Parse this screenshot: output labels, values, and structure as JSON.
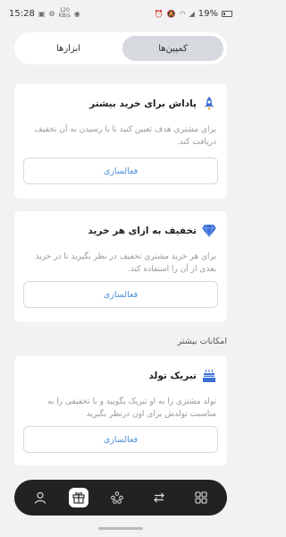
{
  "status_bar": {
    "time": "15:28",
    "network_speed": "120",
    "network_unit": "KB/s",
    "battery": "19%"
  },
  "tabs": {
    "campaigns": "کمپین‌ها",
    "tools": "ابزارها",
    "active": "campaigns"
  },
  "cards": [
    {
      "icon": "rocket-icon",
      "title": "پاداش برای خرید بیشتر",
      "description": "برای مشتری هدف تعیین کنید تا با رسیدن به آن تخفیف دریافت کند.",
      "button": "فعالسازی"
    },
    {
      "icon": "diamond-icon",
      "title": "تخفیف به ازای هر خرید",
      "description": "برای هر خرید مشتری تخفیف در نظر بگیرید تا در خرید بعدی از آن را استفاده کند.",
      "button": "فعالسازی"
    },
    {
      "icon": "cake-icon",
      "title": "تبریک تولد",
      "description": "تولد مشتری را به او تبریک بگویید و با تخفیفی را به مناسبت تولدش برای اون درنظر بگیرید",
      "button": "فعالسازی"
    }
  ],
  "section_label": "امکانات بیشتر",
  "nav": {
    "items": [
      "profile-icon",
      "gift-icon",
      "nodes-icon",
      "transfer-icon",
      "grid-icon"
    ],
    "active_index": 1
  },
  "colors": {
    "accent": "#4a8fd8",
    "nav_bg": "#222222",
    "icon_blue": "#3b6fd6"
  }
}
